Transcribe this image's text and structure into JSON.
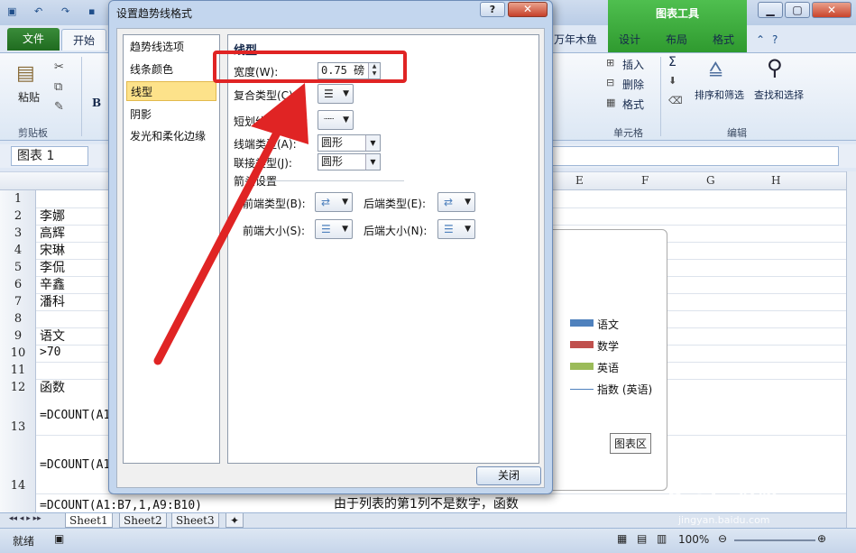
{
  "excel": {
    "ribbon_tabs": {
      "file": "文件",
      "home": "开始",
      "partial_tab": "万年木鱼",
      "chart_tools": "图表工具",
      "design": "设计",
      "layout": "布局",
      "format": "格式"
    },
    "ribbon": {
      "paste": "粘贴",
      "clipboard_group": "剪贴板",
      "bold": "B",
      "insert": "插入",
      "delete": "删除",
      "format": "格式",
      "cells_group": "单元格",
      "sort_filter": "排序和筛选",
      "find_select": "查找和选择",
      "edit_group": "编辑",
      "sigma": "Σ"
    },
    "name_box": "图表 1",
    "columns": [
      "E",
      "F",
      "G",
      "H"
    ],
    "rows": [
      {
        "num": "1",
        "text": ""
      },
      {
        "num": "2",
        "text": "李娜"
      },
      {
        "num": "3",
        "text": "高辉"
      },
      {
        "num": "4",
        "text": "宋琳"
      },
      {
        "num": "5",
        "text": "李侃"
      },
      {
        "num": "6",
        "text": "辛鑫"
      },
      {
        "num": "7",
        "text": "潘科"
      },
      {
        "num": "8",
        "text": ""
      },
      {
        "num": "9",
        "text": "语文"
      },
      {
        "num": "10",
        "text": ">70"
      },
      {
        "num": "11",
        "text": ""
      },
      {
        "num": "12",
        "text": "函数"
      },
      {
        "num": "13",
        "text": "=DCOUNT(A1"
      },
      {
        "num": "14",
        "text": "=DCOUNT(A1"
      }
    ],
    "row15_partial": "=DCOUNT(A1:B7,1,A9:B10)",
    "below_note": "由于列表的第1列不是数字，函数",
    "legend": [
      {
        "label": "语文",
        "color": "#4f81bd"
      },
      {
        "label": "数学",
        "color": "#c0504d"
      },
      {
        "label": "英语",
        "color": "#9bbb59"
      },
      {
        "label": "指数 (英语)",
        "color": "#4f81bd"
      }
    ],
    "chart_tooltip": "图表区",
    "sheet_tabs": [
      "Sheet1",
      "Sheet2",
      "Sheet3"
    ],
    "status": "就绪",
    "zoom": "100%"
  },
  "dialog": {
    "title": "设置趋势线格式",
    "help": "?",
    "close_x": "✕",
    "nav": [
      "趋势线选项",
      "线条颜色",
      "线型",
      "阴影",
      "发光和柔化边缘"
    ],
    "selected_nav": "线型",
    "section_title": "线型",
    "width_label": "宽度(W):",
    "width_value": "0.75 磅",
    "compound_label": "复合类型(C):",
    "dash_label": "短划线类型(D):",
    "cap_label": "线端类型(A):",
    "cap_value": "圆形",
    "join_label": "联接类型(J):",
    "join_value": "圆形",
    "arrow_section": "箭头设置",
    "begin_type_label": "前端类型(B):",
    "end_type_label": "后端类型(E):",
    "begin_size_label": "前端大小(S):",
    "end_size_label": "后端大小(N):",
    "close_button": "关闭"
  },
  "watermark": "Baidu 经验",
  "watermark_sub": "jingyan.baidu.com"
}
